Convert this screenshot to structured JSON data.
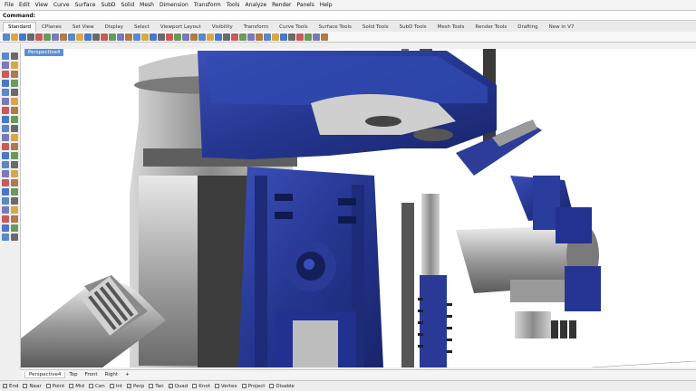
{
  "menu": [
    "File",
    "Edit",
    "View",
    "Curve",
    "Surface",
    "SubD",
    "Solid",
    "Mesh",
    "Dimension",
    "Transform",
    "Tools",
    "Analyze",
    "Render",
    "Panels",
    "Help"
  ],
  "command": {
    "label": "Command:",
    "value": ""
  },
  "toolbar_tabs": [
    {
      "label": "Standard",
      "active": true
    },
    {
      "label": "CPlanes",
      "active": false
    },
    {
      "label": "Set View",
      "active": false
    },
    {
      "label": "Display",
      "active": false
    },
    {
      "label": "Select",
      "active": false
    },
    {
      "label": "Viewport Layout",
      "active": false
    },
    {
      "label": "Visibility",
      "active": false
    },
    {
      "label": "Transform",
      "active": false
    },
    {
      "label": "Curve Tools",
      "active": false
    },
    {
      "label": "Surface Tools",
      "active": false
    },
    {
      "label": "Solid Tools",
      "active": false
    },
    {
      "label": "SubD Tools",
      "active": false
    },
    {
      "label": "Mesh Tools",
      "active": false
    },
    {
      "label": "Render Tools",
      "active": false
    },
    {
      "label": "Drafting",
      "active": false
    },
    {
      "label": "New in V7",
      "active": false
    }
  ],
  "viewport": {
    "title": "Perspective4"
  },
  "view_tabs": [
    {
      "label": "Perspective4",
      "active": true
    },
    {
      "label": "Top",
      "active": false
    },
    {
      "label": "Front",
      "active": false
    },
    {
      "label": "Right",
      "active": false
    },
    {
      "label": "+",
      "active": false
    }
  ],
  "osnaps": [
    {
      "label": "End",
      "checked": true
    },
    {
      "label": "Near",
      "checked": false
    },
    {
      "label": "Point",
      "checked": false
    },
    {
      "label": "Mid",
      "checked": false
    },
    {
      "label": "Cen",
      "checked": false
    },
    {
      "label": "Int",
      "checked": false
    },
    {
      "label": "Perp",
      "checked": true
    },
    {
      "label": "Tan",
      "checked": false
    },
    {
      "label": "Quad",
      "checked": true
    },
    {
      "label": "Knot",
      "checked": false
    },
    {
      "label": "Vertex",
      "checked": false
    },
    {
      "label": "Project",
      "checked": false
    },
    {
      "label": "Disable",
      "checked": false
    }
  ],
  "colors": {
    "accent": "#5a8fd6",
    "model_blue": "#2b3c9a",
    "metal": "#b8b8b8"
  }
}
